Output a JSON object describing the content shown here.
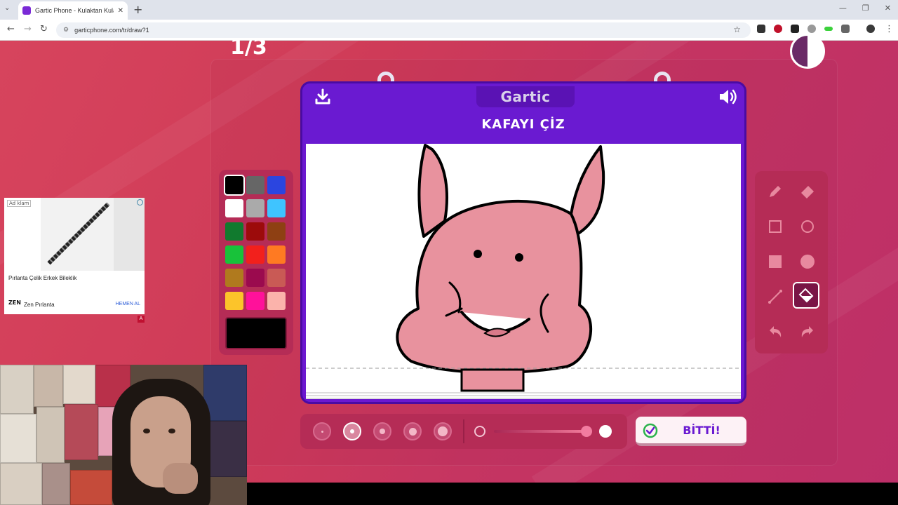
{
  "browser": {
    "tab_title": "Gartic Phone - Kulaktan Kulağa",
    "url": "garticphone.com/tr/draw?1"
  },
  "game": {
    "round_counter": "1/3",
    "logo": "Gartic",
    "prompt": "KAFAYI ÇİZ",
    "done_label": "BİTTİ!",
    "timer_remaining_fraction": 0.5,
    "selected_color": "#000000",
    "selected_tool": "fill-bucket",
    "selected_brush_size": 2
  },
  "palette": {
    "colors": [
      "#000000",
      "#666666",
      "#2b45e0",
      "#ffffff",
      "#aaaaaa",
      "#3fc4ff",
      "#117a2e",
      "#9c0b0b",
      "#8e4013",
      "#18c23a",
      "#f2201c",
      "#ff7a22",
      "#b07a1e",
      "#9b0a4e",
      "#c95a55",
      "#fcc42a",
      "#ff119a",
      "#fbb3ab"
    ]
  },
  "tools": {
    "items": [
      "pencil-icon",
      "eraser-icon",
      "rect-outline-icon",
      "circle-outline-icon",
      "rect-fill-icon",
      "circle-fill-icon",
      "line-icon",
      "fill-bucket-icon",
      "undo-icon",
      "redo-icon"
    ]
  },
  "ad": {
    "label": "Ad klam",
    "title": "Pırlanta Çelik Erkek Bileklik",
    "brand_logo": "ZEN",
    "brand": "Zen Pırlanta",
    "cta": "HEMEN AL",
    "badge": "A"
  }
}
